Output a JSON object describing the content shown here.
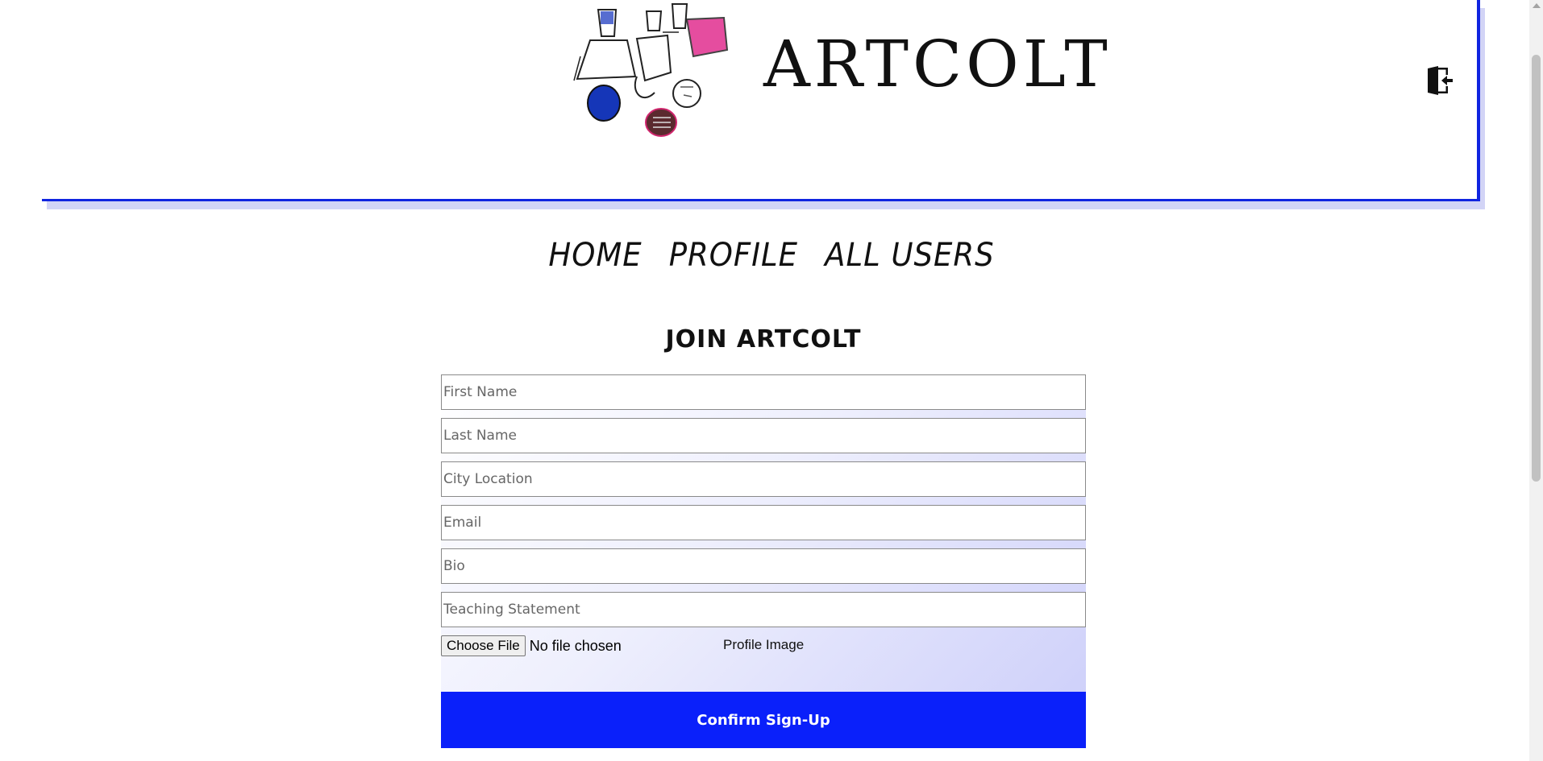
{
  "header": {
    "brand_title": "ARTCOLT",
    "logo_icon": "ceramic-vessels-sketch",
    "signout_icon": "door-exit-icon"
  },
  "nav": {
    "items": [
      {
        "label": "HOME"
      },
      {
        "label": "PROFILE"
      },
      {
        "label": "ALL USERS"
      }
    ]
  },
  "form": {
    "title": "JOIN ARTCOLT",
    "fields": [
      {
        "placeholder": "First Name",
        "value": ""
      },
      {
        "placeholder": "Last Name",
        "value": ""
      },
      {
        "placeholder": "City Location",
        "value": ""
      },
      {
        "placeholder": "Email",
        "value": ""
      },
      {
        "placeholder": "Bio",
        "value": ""
      },
      {
        "placeholder": "Teaching Statement",
        "value": ""
      }
    ],
    "file": {
      "button_label": "Choose File",
      "status": "No file chosen",
      "label": "Profile Image"
    },
    "submit_label": "Confirm Sign-Up"
  },
  "colors": {
    "accent": "#0a20fa",
    "header_border": "#1024e0",
    "shadow": "#d2d4f6",
    "gradient_end": "#cfd1fa"
  }
}
